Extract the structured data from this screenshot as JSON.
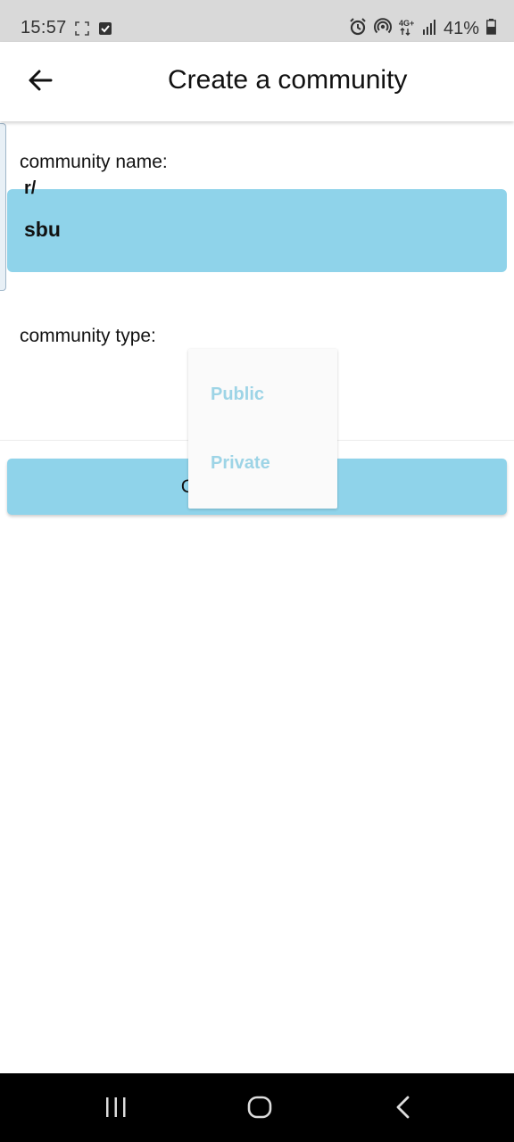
{
  "status_bar": {
    "time": "15:57",
    "battery": "41%",
    "icons": [
      "screenshot-icon",
      "check-box-icon",
      "alarm-icon",
      "hotspot-icon",
      "network-4g-icon",
      "signal-icon",
      "battery-icon"
    ]
  },
  "app_bar": {
    "back_icon": "arrow-left-icon",
    "title": "Create a community"
  },
  "form": {
    "name_label": "community name:",
    "name_prefix": "r/",
    "name_value": "sbu",
    "type_label": "community type:",
    "create_button_label": "Create community"
  },
  "dropdown": {
    "options": [
      {
        "label": "Public"
      },
      {
        "label": "Private"
      }
    ]
  },
  "nav_bar": {
    "buttons": [
      "recent-apps-icon",
      "home-icon",
      "back-icon"
    ]
  },
  "colors": {
    "accent": "#8fd3ea",
    "dropdown_text": "#9dd4e6",
    "status_bar_bg": "#d9d9d9",
    "nav_bar_bg": "#000000"
  }
}
